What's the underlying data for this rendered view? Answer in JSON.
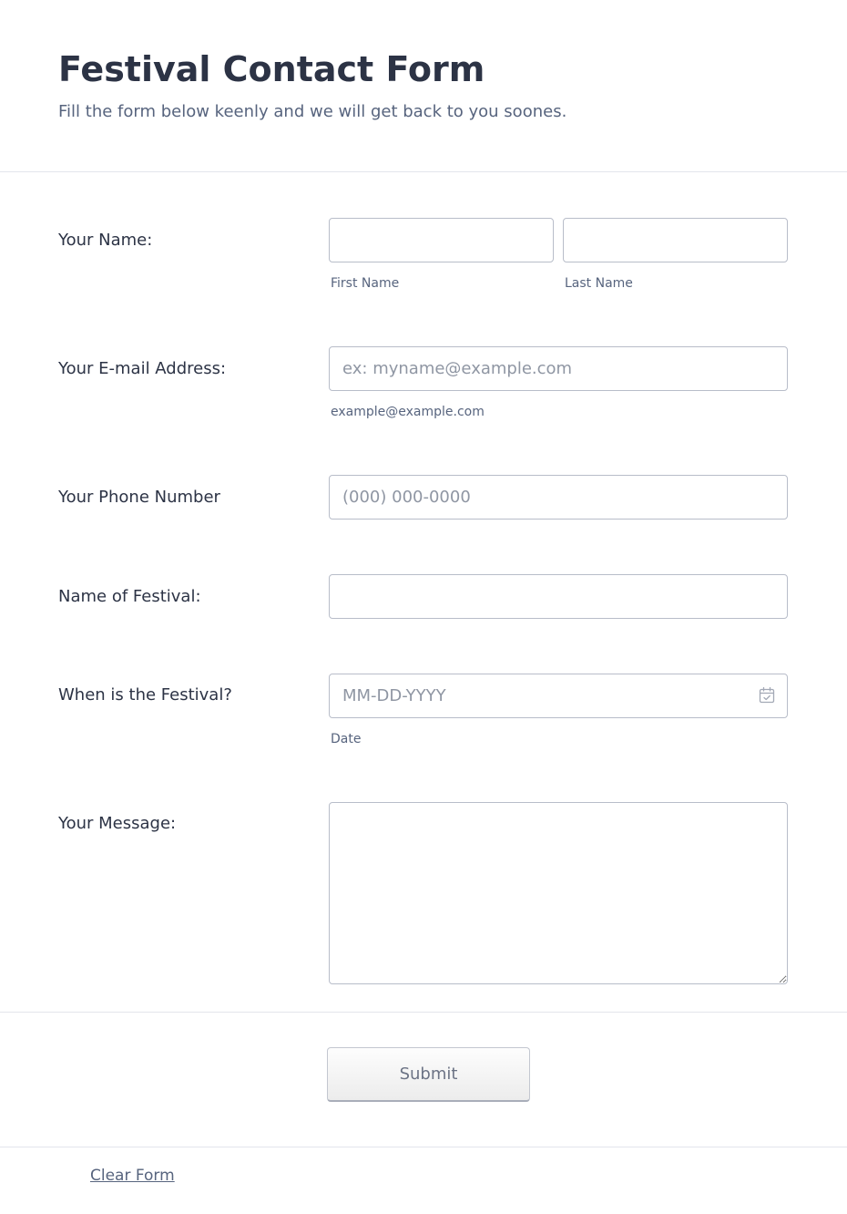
{
  "header": {
    "title": "Festival Contact Form",
    "subtitle": "Fill the form below keenly and we will get back to you soones."
  },
  "fields": {
    "name": {
      "label": "Your Name:",
      "first_sublabel": "First Name",
      "last_sublabel": "Last Name",
      "first_value": "",
      "last_value": ""
    },
    "email": {
      "label": "Your E-mail Address:",
      "placeholder": "ex: myname@example.com",
      "sublabel": "example@example.com",
      "value": ""
    },
    "phone": {
      "label": "Your Phone Number",
      "placeholder": "(000) 000-0000",
      "value": ""
    },
    "festival_name": {
      "label": "Name of Festival:",
      "value": ""
    },
    "festival_date": {
      "label": "When is the Festival?",
      "placeholder": "MM-DD-YYYY",
      "sublabel": "Date",
      "icon": "calendar-icon",
      "value": ""
    },
    "message": {
      "label": "Your Message:",
      "value": ""
    }
  },
  "actions": {
    "submit_label": "Submit",
    "clear_label": "Clear Form"
  },
  "colors": {
    "text": "#2c3345",
    "muted": "#57647e",
    "border": "#b8bdc9",
    "divider": "#e3e5ec"
  }
}
